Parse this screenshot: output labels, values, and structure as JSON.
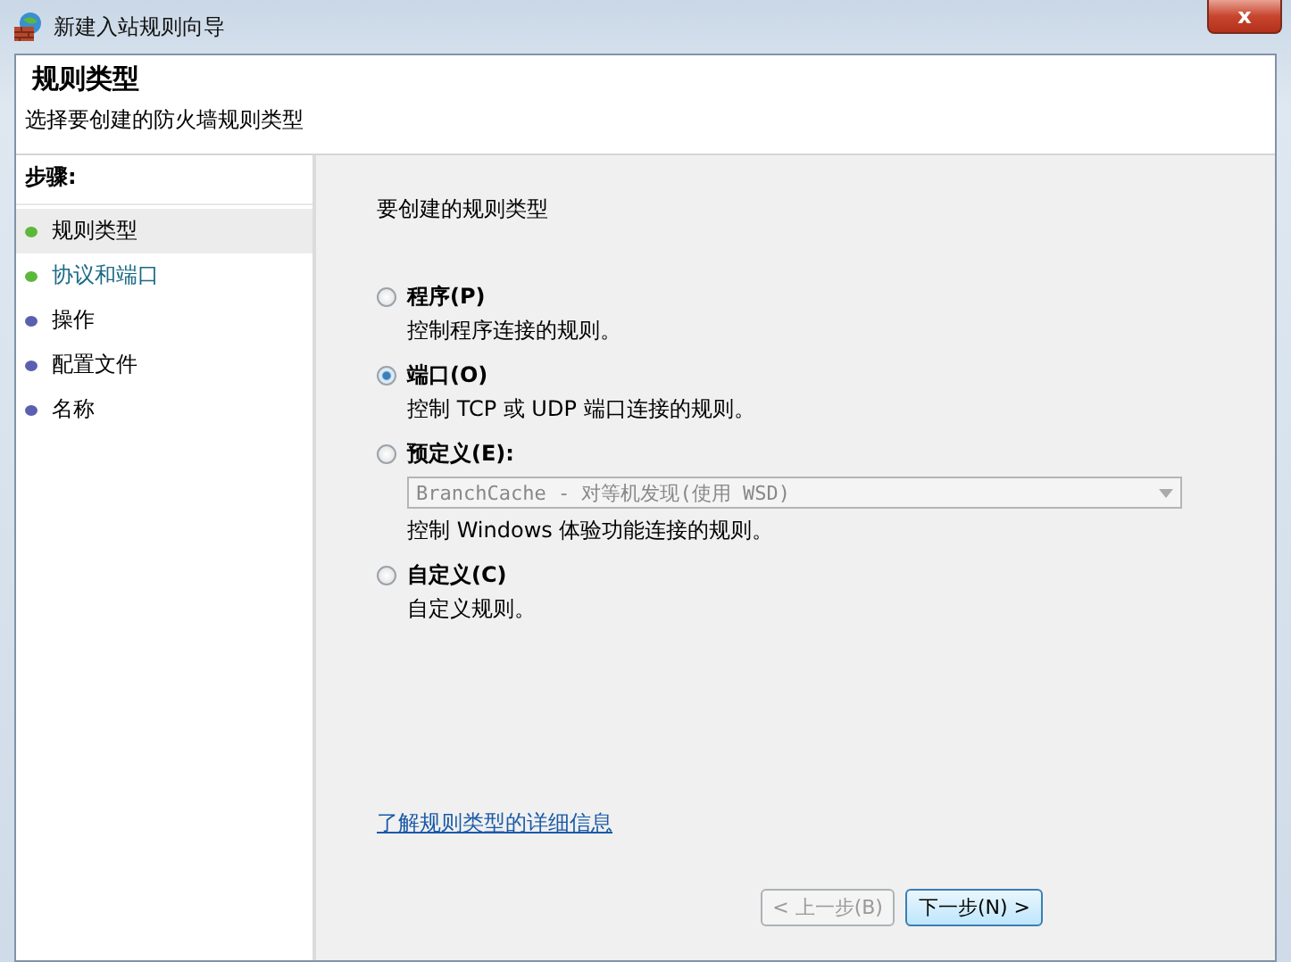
{
  "window": {
    "title": "新建入站规则向导",
    "close": "x"
  },
  "header": {
    "title": "规则类型",
    "subtitle": "选择要创建的防火墙规则类型"
  },
  "steps": {
    "title": "步骤:",
    "items": [
      {
        "label": "规则类型",
        "selected": true,
        "hovered": false,
        "color": "#5cb83a"
      },
      {
        "label": "协议和端口",
        "selected": false,
        "hovered": true,
        "color": "#5cb83a"
      },
      {
        "label": "操作",
        "selected": false,
        "hovered": false,
        "color": "#5b5fb0"
      },
      {
        "label": "配置文件",
        "selected": false,
        "hovered": false,
        "color": "#5b5fb0"
      },
      {
        "label": "名称",
        "selected": false,
        "hovered": false,
        "color": "#5b5fb0"
      }
    ]
  },
  "content": {
    "prompt": "要创建的规则类型",
    "options": [
      {
        "label": "程序(P)",
        "description": "控制程序连接的规则。",
        "selected": false
      },
      {
        "label": "端口(O)",
        "description": "控制 TCP 或 UDP 端口连接的规则。",
        "selected": true
      },
      {
        "label": "预定义(E):",
        "dropdown": {
          "value": "BranchCache - 对等机发现(使用 WSD)",
          "disabled": true
        },
        "description": "控制 Windows 体验功能连接的规则。",
        "selected": false
      },
      {
        "label": "自定义(C)",
        "description": "自定义规则。",
        "selected": false
      }
    ],
    "link": "了解规则类型的详细信息"
  },
  "buttons": [
    {
      "label": "< 上一步(B)",
      "disabled": true
    },
    {
      "label": "下一步(N) >",
      "disabled": false
    }
  ]
}
